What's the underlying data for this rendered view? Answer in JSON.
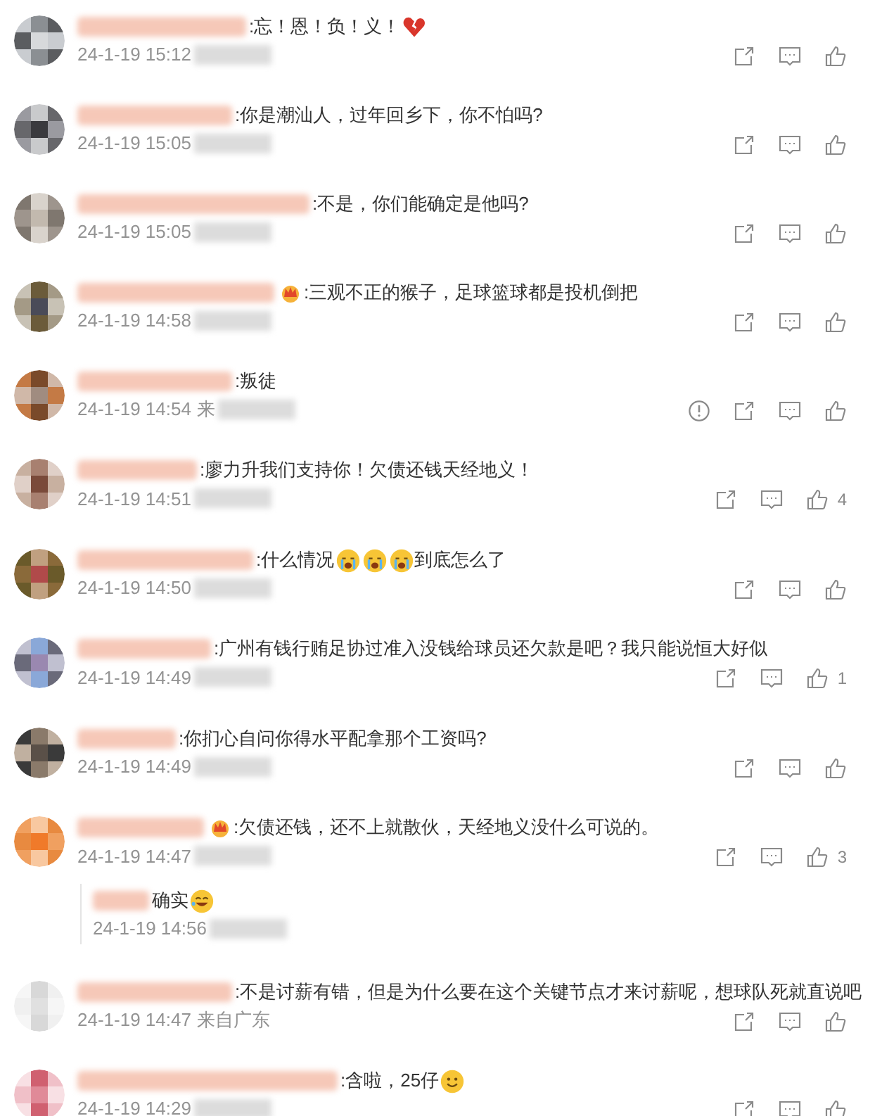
{
  "comments": [
    {
      "badge": false,
      "parts": [
        {
          "kind": "text",
          "text": ":忘！恩！负！义！"
        },
        {
          "kind": "broken_heart"
        }
      ],
      "time": "24-1-19 15:12",
      "report": false
    },
    {
      "badge": false,
      "parts": [
        {
          "kind": "text",
          "text": ":你是潮汕人，过年回乡下，你不怕吗?"
        }
      ],
      "time": "24-1-19 15:05",
      "report": false
    },
    {
      "badge": false,
      "parts": [
        {
          "kind": "text",
          "text": ":不是，你们能确定是他吗?"
        }
      ],
      "time": "24-1-19 15:05",
      "report": false
    },
    {
      "badge": true,
      "parts": [
        {
          "kind": "text",
          "text": ":三观不正的猴子，足球篮球都是投机倒把"
        }
      ],
      "time": "24-1-19 14:58",
      "report": false
    },
    {
      "badge": false,
      "parts": [
        {
          "kind": "text",
          "text": ":叛徒"
        }
      ],
      "time": "24-1-19 14:54",
      "location": "来",
      "report": true
    },
    {
      "badge": false,
      "parts": [
        {
          "kind": "text",
          "text": ":廖力升我们支持你！欠债还钱天经地义！"
        }
      ],
      "time": "24-1-19 14:51",
      "likes": "4",
      "report": false
    },
    {
      "badge": false,
      "parts": [
        {
          "kind": "text",
          "text": ":什么情况"
        },
        {
          "kind": "crying"
        },
        {
          "kind": "crying"
        },
        {
          "kind": "crying"
        },
        {
          "kind": "text",
          "text": "到底怎么了"
        }
      ],
      "time": "24-1-19 14:50",
      "report": false
    },
    {
      "badge": false,
      "parts": [
        {
          "kind": "text",
          "text": ":广州有钱行贿足协过准入没钱给球员还欠款是吧？我只能说恒大好似"
        }
      ],
      "time": "24-1-19 14:49",
      "likes": "1",
      "report": false
    },
    {
      "badge": false,
      "parts": [
        {
          "kind": "text",
          "text": ":你扪心自问你得水平配拿那个工资吗?"
        }
      ],
      "time": "24-1-19 14:49",
      "report": false
    },
    {
      "badge": true,
      "parts": [
        {
          "kind": "text",
          "text": ":欠债还钱，还不上就散伙，天经地义没什么可说的。"
        }
      ],
      "time": "24-1-19 14:47",
      "likes": "3",
      "report": false,
      "replies": [
        {
          "parts": [
            {
              "kind": "text",
              "text": "确实"
            },
            {
              "kind": "laughing"
            }
          ],
          "time": "24-1-19 14:56"
        }
      ]
    },
    {
      "badge": false,
      "parts": [
        {
          "kind": "text",
          "text": ":不是讨薪有错，但是为什么要在这个关键节点才来讨薪呢，想球队死就直说吧"
        }
      ],
      "time": "24-1-19 14:47",
      "location": "来自广东",
      "report": false
    },
    {
      "badge": false,
      "parts": [
        {
          "kind": "text",
          "text": ":含啦，25仔"
        },
        {
          "kind": "smile"
        }
      ],
      "time": "24-1-19 14:29",
      "report": false
    }
  ]
}
